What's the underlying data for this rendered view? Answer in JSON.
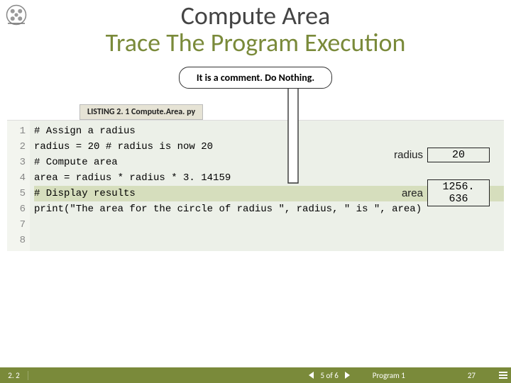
{
  "header": {
    "title_line1": "Compute Area",
    "title_line2": "Trace The Program Execution"
  },
  "callout": {
    "text": "It is a comment. Do Nothing."
  },
  "listing": {
    "label": "LISTING 2. 1 Compute.Area. py",
    "gutter": [
      "1",
      "2",
      "3",
      "4",
      "5",
      "6",
      "7",
      "8"
    ],
    "lines": {
      "l1": "# Assign a radius",
      "l2": "radius = 20 # radius is now 20",
      "l3": "",
      "l4": "# Compute area",
      "l5": "area = radius * radius * 3. 14159",
      "l6": "",
      "l7": "# Display results",
      "l8": "print(\"The area for the circle of radius \", radius, \" is \", area)"
    },
    "highlight_index": 6
  },
  "variables": [
    {
      "name": "radius",
      "value": "20"
    },
    {
      "name": "area",
      "value": "1256. 636"
    }
  ],
  "footer": {
    "section": "2. 2",
    "position": "5 of 6",
    "program_label": "Program 1",
    "page": "27"
  }
}
